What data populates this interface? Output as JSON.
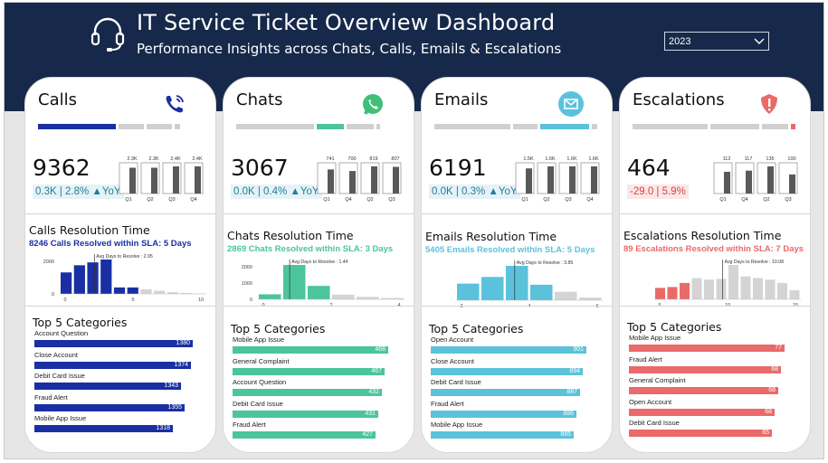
{
  "header": {
    "title": "IT Service Ticket Overview Dashboard",
    "subtitle": "Performance Insights across Chats, Calls, Emails & Escalations",
    "year_filter": "2023",
    "icon": "headset-icon"
  },
  "colors": {
    "header_bg": "#16294a",
    "calls": "#1a2fa3",
    "chats": "#4cc49c",
    "emails": "#5bc2dc",
    "escalations": "#ea6a6a",
    "neutral_bar": "#595959",
    "inactive": "#d0d0d0"
  },
  "cards": [
    {
      "key": "calls",
      "title": "Calls",
      "icon": "phone-icon",
      "total": "9362",
      "delta": "0.3K | 2.8% ▲YoY",
      "delta_color": "#1e7f9a",
      "delta_bg": "#e6f2f8",
      "segments": [
        1,
        0,
        0,
        0
      ],
      "active_segment": 0,
      "mini_bars": [
        {
          "q": "Q1",
          "label": "2.3K",
          "value": 2.3
        },
        {
          "q": "Q2",
          "label": "2.3K",
          "value": 2.3
        },
        {
          "q": "Q3",
          "label": "2.4K",
          "value": 2.4
        },
        {
          "q": "Q4",
          "label": "2.4K",
          "value": 2.4
        }
      ],
      "resolution_title": "Calls Resolution Time",
      "resolution_sub": "8246 Calls Resolved within SLA: 5 Days",
      "hist": {
        "values": [
          1500,
          2000,
          2200,
          2400,
          450,
          450,
          330,
          220,
          120,
          70,
          30
        ],
        "sla_index": 5,
        "avg_label": "Avg Days to Resolve : 2.95",
        "y_ticks": [
          "2000",
          "0"
        ],
        "x_ticks": [
          "0",
          "5",
          "10"
        ]
      },
      "top5": [
        {
          "label": "Account Question",
          "value": 1380
        },
        {
          "label": "Close Account",
          "value": 1374
        },
        {
          "label": "Debit Card Issue",
          "value": 1343
        },
        {
          "label": "Fraud Alert",
          "value": 1355
        },
        {
          "label": "Mobile App Issue",
          "value": 1318
        }
      ]
    },
    {
      "key": "chats",
      "title": "Chats",
      "icon": "whatsapp-icon",
      "total": "3067",
      "delta": "0.0K | 0.4% ▲YoY",
      "delta_color": "#1e7f9a",
      "delta_bg": "#e6f2f8",
      "segments": [
        0,
        1,
        0,
        0
      ],
      "active_segment": 1,
      "mini_bars": [
        {
          "q": "Q1",
          "label": "741",
          "value": 741
        },
        {
          "q": "Q4",
          "label": "700",
          "value": 700
        },
        {
          "q": "Q2",
          "label": "819",
          "value": 819
        },
        {
          "q": "Q3",
          "label": "807",
          "value": 807
        }
      ],
      "resolution_title": "Chats Resolution Time",
      "resolution_sub": "2869 Chats Resolved within SLA: 3 Days",
      "hist": {
        "values": [
          300,
          2050,
          800,
          280,
          150,
          80
        ],
        "sla_index": 3,
        "avg_label": "Avg Days to Resolve : 1.44",
        "y_ticks": [
          "2000",
          "1000",
          "0"
        ],
        "x_ticks": [
          "0",
          "2",
          "4"
        ]
      },
      "top5": [
        {
          "label": "Mobile App Issue",
          "value": 468
        },
        {
          "label": "General Complaint",
          "value": 467
        },
        {
          "label": "Account Question",
          "value": 432
        },
        {
          "label": "Debit Card Issue",
          "value": 431
        },
        {
          "label": "Fraud Alert",
          "value": 427
        }
      ]
    },
    {
      "key": "emails",
      "title": "Emails",
      "icon": "envelope-icon",
      "total": "6191",
      "delta": "0.0K | 0.3% ▲YoY",
      "delta_color": "#1e7f9a",
      "delta_bg": "#e6f2f8",
      "segments": [
        0,
        0,
        1,
        0
      ],
      "active_segment": 2,
      "mini_bars": [
        {
          "q": "Q1",
          "label": "1.5K",
          "value": 1.5
        },
        {
          "q": "Q2",
          "label": "1.6K",
          "value": 1.6
        },
        {
          "q": "Q3",
          "label": "1.6K",
          "value": 1.6
        },
        {
          "q": "Q4",
          "label": "1.6K",
          "value": 1.6
        }
      ],
      "resolution_title": "Emails Resolution Time",
      "resolution_sub": "5405 Emails Resolved within SLA: 5 Days",
      "hist": {
        "values": [
          750,
          1050,
          1550,
          700,
          380,
          120
        ],
        "sla_index": 4,
        "avg_label": "Avg Days to Resolve : 3.85",
        "y_ticks": [],
        "x_ticks": [
          "2",
          "4",
          "6"
        ]
      },
      "top5": [
        {
          "label": "Open Account",
          "value": 901
        },
        {
          "label": "Close Account",
          "value": 894
        },
        {
          "label": "Debit Card Issue",
          "value": 887
        },
        {
          "label": "Fraud Alert",
          "value": 886
        },
        {
          "label": "Mobile App Issue",
          "value": 885
        }
      ]
    },
    {
      "key": "escalations",
      "title": "Escalations",
      "icon": "shield-alert-icon",
      "total": "464",
      "delta": "-29.0 | 5.9%",
      "delta_color": "#d64545",
      "delta_bg": "#fbe7e7",
      "segments": [
        0,
        0,
        0,
        1
      ],
      "active_segment": 3,
      "mini_bars": [
        {
          "q": "Q1",
          "label": "112",
          "value": 112
        },
        {
          "q": "Q4",
          "label": "117",
          "value": 117
        },
        {
          "q": "Q2",
          "label": "135",
          "value": 135
        },
        {
          "q": "Q3",
          "label": "100",
          "value": 100
        }
      ],
      "resolution_title": "Escalations Resolution Time",
      "resolution_sub": "89 Escalations Resolved within SLA: 7 Days",
      "hist": {
        "values": [
          14,
          15,
          20,
          26,
          24,
          25,
          42,
          28,
          26,
          24,
          20,
          11
        ],
        "sla_index": 3,
        "avg_label": "Avg Days to Resolve : 10.08",
        "y_ticks": [],
        "x_ticks": [
          "5",
          "10",
          "15"
        ]
      },
      "top5": [
        {
          "label": "Mobile App Issue",
          "value": 77
        },
        {
          "label": "Fraud Alert",
          "value": 68
        },
        {
          "label": "General Complaint",
          "value": 68
        },
        {
          "label": "Open Account",
          "value": 68
        },
        {
          "label": "Debit Card Issue",
          "value": 65
        }
      ]
    }
  ],
  "labels": {
    "top5_title": "Top 5 Categories"
  }
}
